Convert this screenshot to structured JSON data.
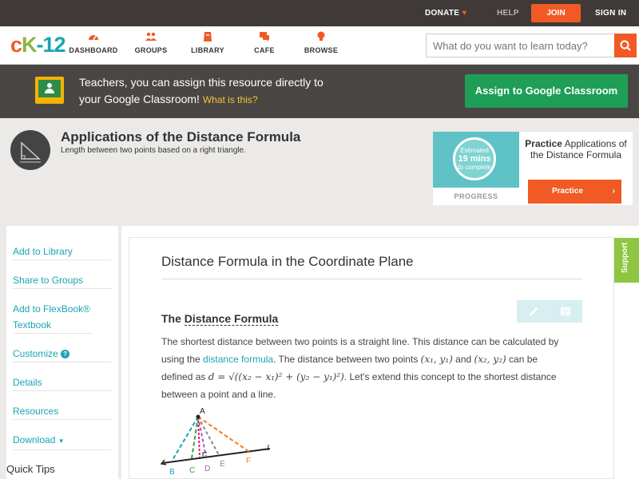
{
  "topbar": {
    "donate": "DONATE",
    "help": "HELP",
    "join": "JOIN",
    "signin": "SIGN IN"
  },
  "nav": {
    "logo": {
      "c": "c",
      "k": "K",
      "n": "-12"
    },
    "items": [
      {
        "label": "DASHBOARD",
        "icon": "dashboard-icon"
      },
      {
        "label": "GROUPS",
        "icon": "groups-icon"
      },
      {
        "label": "LIBRARY",
        "icon": "library-icon"
      },
      {
        "label": "CAFE",
        "icon": "cafe-icon"
      },
      {
        "label": "BROWSE",
        "icon": "lightbulb-icon"
      }
    ],
    "search_placeholder": "What do you want to learn today?"
  },
  "banner": {
    "line1": "Teachers, you can assign this resource directly to",
    "line2": "your Google Classroom!",
    "what": "What is this?",
    "assign_button": "Assign to Google Classroom"
  },
  "concept": {
    "title": "Applications of the Distance Formula",
    "subtitle": "Length between two points based on a right triangle."
  },
  "practice": {
    "estimated": "Estimated",
    "mins": "19 mins",
    "to_complete": "to complete",
    "progress": "PROGRESS",
    "title_bold": "Practice",
    "title_rest": " Applications of the Distance Formula",
    "button": "Practice"
  },
  "sidebar": {
    "items": [
      "Add to Library",
      "Share to Groups",
      "Add to FlexBook® Textbook",
      "Customize",
      "Details",
      "Resources",
      "Download"
    ],
    "download_arrow": "▼",
    "quick_tips": "Quick Tips"
  },
  "main": {
    "section_title": "Distance Formula in the Coordinate Plane",
    "heading_pre": "The ",
    "heading_u": "Distance Formula",
    "p1": "The shortest distance between two points is a straight line. This distance can be calculated by",
    "p2a": "using the ",
    "p2link": "distance formula",
    "p2b": ". The distance between two points ",
    "p3a": "defined as ",
    "p3b": ". Let's extend this concept to the shortest distance",
    "p4": "between a point and a line.",
    "and": " and ",
    "can_be": " can be",
    "pt1": "(x₁, y₁)",
    "pt2": "(x₂, y₂)",
    "formula": "d = √((x₂ − x₁)² + (y₂ − y₁)²)",
    "support": "Support"
  },
  "diagram": {
    "labels": [
      "A",
      "B",
      "C",
      "D",
      "E",
      "F",
      "l"
    ],
    "colors": {
      "B": "#1aa4b4",
      "C": "#3aa14a",
      "D": "#a35bc4",
      "E": "#888888",
      "F": "#f47a20"
    }
  }
}
